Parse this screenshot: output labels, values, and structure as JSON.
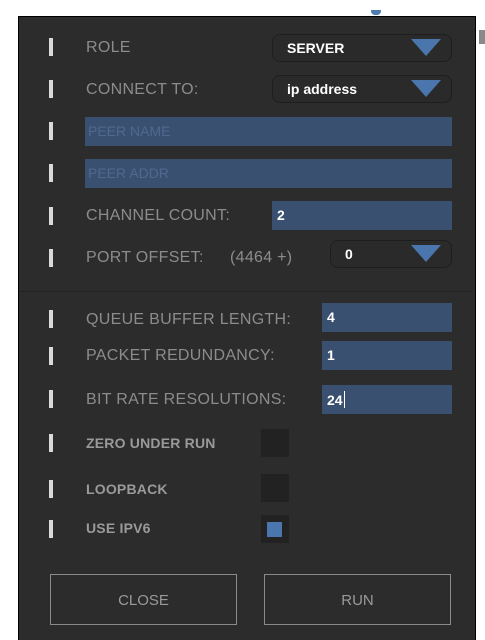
{
  "role": {
    "label": "ROLE",
    "value": "SERVER"
  },
  "connect_to": {
    "label": "CONNECT TO:",
    "value": "ip address"
  },
  "peer_name": {
    "placeholder": "PEER NAME",
    "value": ""
  },
  "peer_addr": {
    "placeholder": "PEER ADDR",
    "value": ""
  },
  "channel_count": {
    "label": "CHANNEL COUNT:",
    "value": "2"
  },
  "port_offset": {
    "label": "PORT OFFSET:",
    "base": "(4464 +)",
    "value": "0"
  },
  "queue_buffer_length": {
    "label": "QUEUE BUFFER LENGTH:",
    "value": "4"
  },
  "packet_redundancy": {
    "label": "PACKET REDUNDANCY:",
    "value": "1"
  },
  "bit_rate_resolutions": {
    "label": "BIT RATE RESOLUTIONS:",
    "value": "24"
  },
  "zero_under_run": {
    "label": "ZERO UNDER RUN",
    "checked": false
  },
  "loopback": {
    "label": "LOOPBACK",
    "checked": false
  },
  "use_ipv6": {
    "label": "USE IPV6",
    "checked": true
  },
  "buttons": {
    "close": "CLOSE",
    "run": "RUN"
  },
  "colors": {
    "panel": "#2c2c2c",
    "accent": "#4a76ad",
    "field": "#3a5070"
  }
}
